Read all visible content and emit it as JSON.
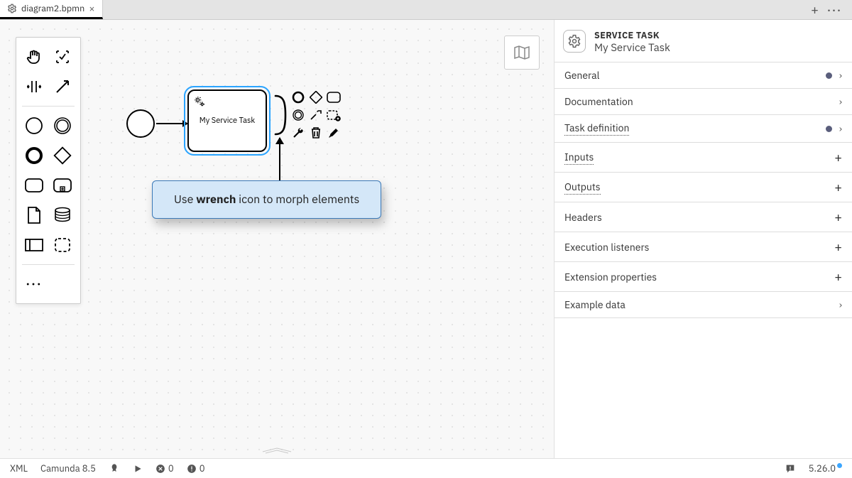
{
  "tabs": {
    "active": {
      "name": "diagram2.bpmn"
    }
  },
  "tooltip": {
    "prefix": "Use ",
    "bold": "wrench",
    "suffix": " icon to morph elements"
  },
  "task": {
    "label": "My Service Task"
  },
  "panel": {
    "type": "SERVICE TASK",
    "name": "My Service Task",
    "sections": {
      "general": "General",
      "documentation": "Documentation",
      "taskdef": "Task definition",
      "inputs": "Inputs",
      "outputs": "Outputs",
      "headers": "Headers",
      "execlisteners": "Execution listeners",
      "extprops": "Extension properties",
      "exampledata": "Example data"
    }
  },
  "footer": {
    "xml": "XML",
    "platform": "Camunda 8.5",
    "errors": "0",
    "warnings": "0",
    "version": "5.26.0"
  }
}
